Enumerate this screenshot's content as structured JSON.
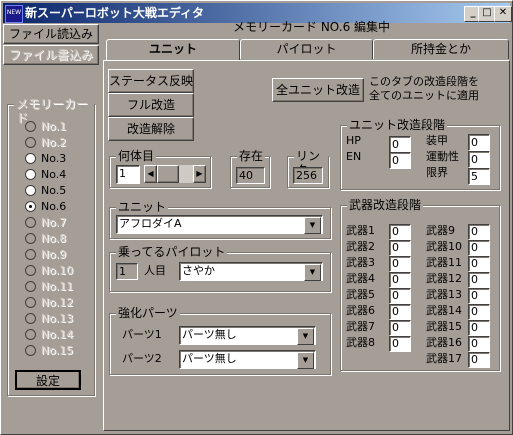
{
  "window": {
    "title": "新スーパーロボット大戦エディタ",
    "icon_text": "NEW",
    "min_label": "_",
    "max_label": "□",
    "close_label": "✕"
  },
  "header": {
    "editing_status": "メモリーカード NO.6 編集中"
  },
  "left": {
    "file_read": "ファイル読込み",
    "file_write": "ファイル書込み",
    "memory_card_label": "メモリーカード",
    "slots": [
      {
        "label": "No.1",
        "enabled": false,
        "selected": false
      },
      {
        "label": "No.2",
        "enabled": false,
        "selected": false
      },
      {
        "label": "No.3",
        "enabled": true,
        "selected": false
      },
      {
        "label": "No.4",
        "enabled": true,
        "selected": false
      },
      {
        "label": "No.5",
        "enabled": true,
        "selected": false
      },
      {
        "label": "No.6",
        "enabled": true,
        "selected": true
      },
      {
        "label": "No.7",
        "enabled": false,
        "selected": false
      },
      {
        "label": "No.8",
        "enabled": false,
        "selected": false
      },
      {
        "label": "No.9",
        "enabled": false,
        "selected": false
      },
      {
        "label": "No.10",
        "enabled": false,
        "selected": false
      },
      {
        "label": "No.11",
        "enabled": false,
        "selected": false
      },
      {
        "label": "No.12",
        "enabled": false,
        "selected": false
      },
      {
        "label": "No.13",
        "enabled": false,
        "selected": false
      },
      {
        "label": "No.14",
        "enabled": false,
        "selected": false
      },
      {
        "label": "No.15",
        "enabled": false,
        "selected": false
      }
    ],
    "settings_button": "設定"
  },
  "tabs": [
    {
      "label": "ユニット",
      "active": true
    },
    {
      "label": "パイロット",
      "active": false
    },
    {
      "label": "所持金とか",
      "active": false
    }
  ],
  "unit": {
    "status_reflect": "ステータス反映",
    "full_upgrade": "フル改造",
    "remove_upgrade": "改造解除",
    "all_upgrade_button": "全ユニット改造",
    "all_upgrade_note": "このタブの改造段階を\n全てのユニットに適用",
    "nth_label": "何体目",
    "nth_value": "1",
    "exist_label": "存在",
    "exist_value": "40",
    "link_label": "リンク",
    "link_value": "256",
    "unit_label": "ユニット",
    "unit_value": "アフロダイA",
    "pilot_label": "乗ってるパイロット",
    "pilot_num": "1",
    "pilot_unit_suffix": "人目",
    "pilot_value": "さやか",
    "parts_label": "強化パーツ",
    "part1_label": "パーツ1",
    "part1_value": "パーツ無し",
    "part2_label": "パーツ2",
    "part2_value": "パーツ無し"
  },
  "unit_stage": {
    "label": "ユニット改造段階",
    "hp_label": "HP",
    "hp_value": "0",
    "en_label": "EN",
    "en_value": "0",
    "armor_label": "装甲",
    "armor_value": "0",
    "mobility_label": "運動性",
    "mobility_value": "0",
    "limit_label": "限界",
    "limit_value": "5"
  },
  "weapon_stage": {
    "label": "武器改造段階",
    "left": [
      {
        "label": "武器1",
        "value": "0"
      },
      {
        "label": "武器2",
        "value": "0"
      },
      {
        "label": "武器3",
        "value": "0"
      },
      {
        "label": "武器4",
        "value": "0"
      },
      {
        "label": "武器5",
        "value": "0"
      },
      {
        "label": "武器6",
        "value": "0"
      },
      {
        "label": "武器7",
        "value": "0"
      },
      {
        "label": "武器8",
        "value": "0"
      }
    ],
    "right": [
      {
        "label": "武器9",
        "value": "0"
      },
      {
        "label": "武器10",
        "value": "0"
      },
      {
        "label": "武器11",
        "value": "0"
      },
      {
        "label": "武器12",
        "value": "0"
      },
      {
        "label": "武器13",
        "value": "0"
      },
      {
        "label": "武器14",
        "value": "0"
      },
      {
        "label": "武器15",
        "value": "0"
      },
      {
        "label": "武器16",
        "value": "0"
      },
      {
        "label": "武器17",
        "value": "0"
      }
    ]
  }
}
